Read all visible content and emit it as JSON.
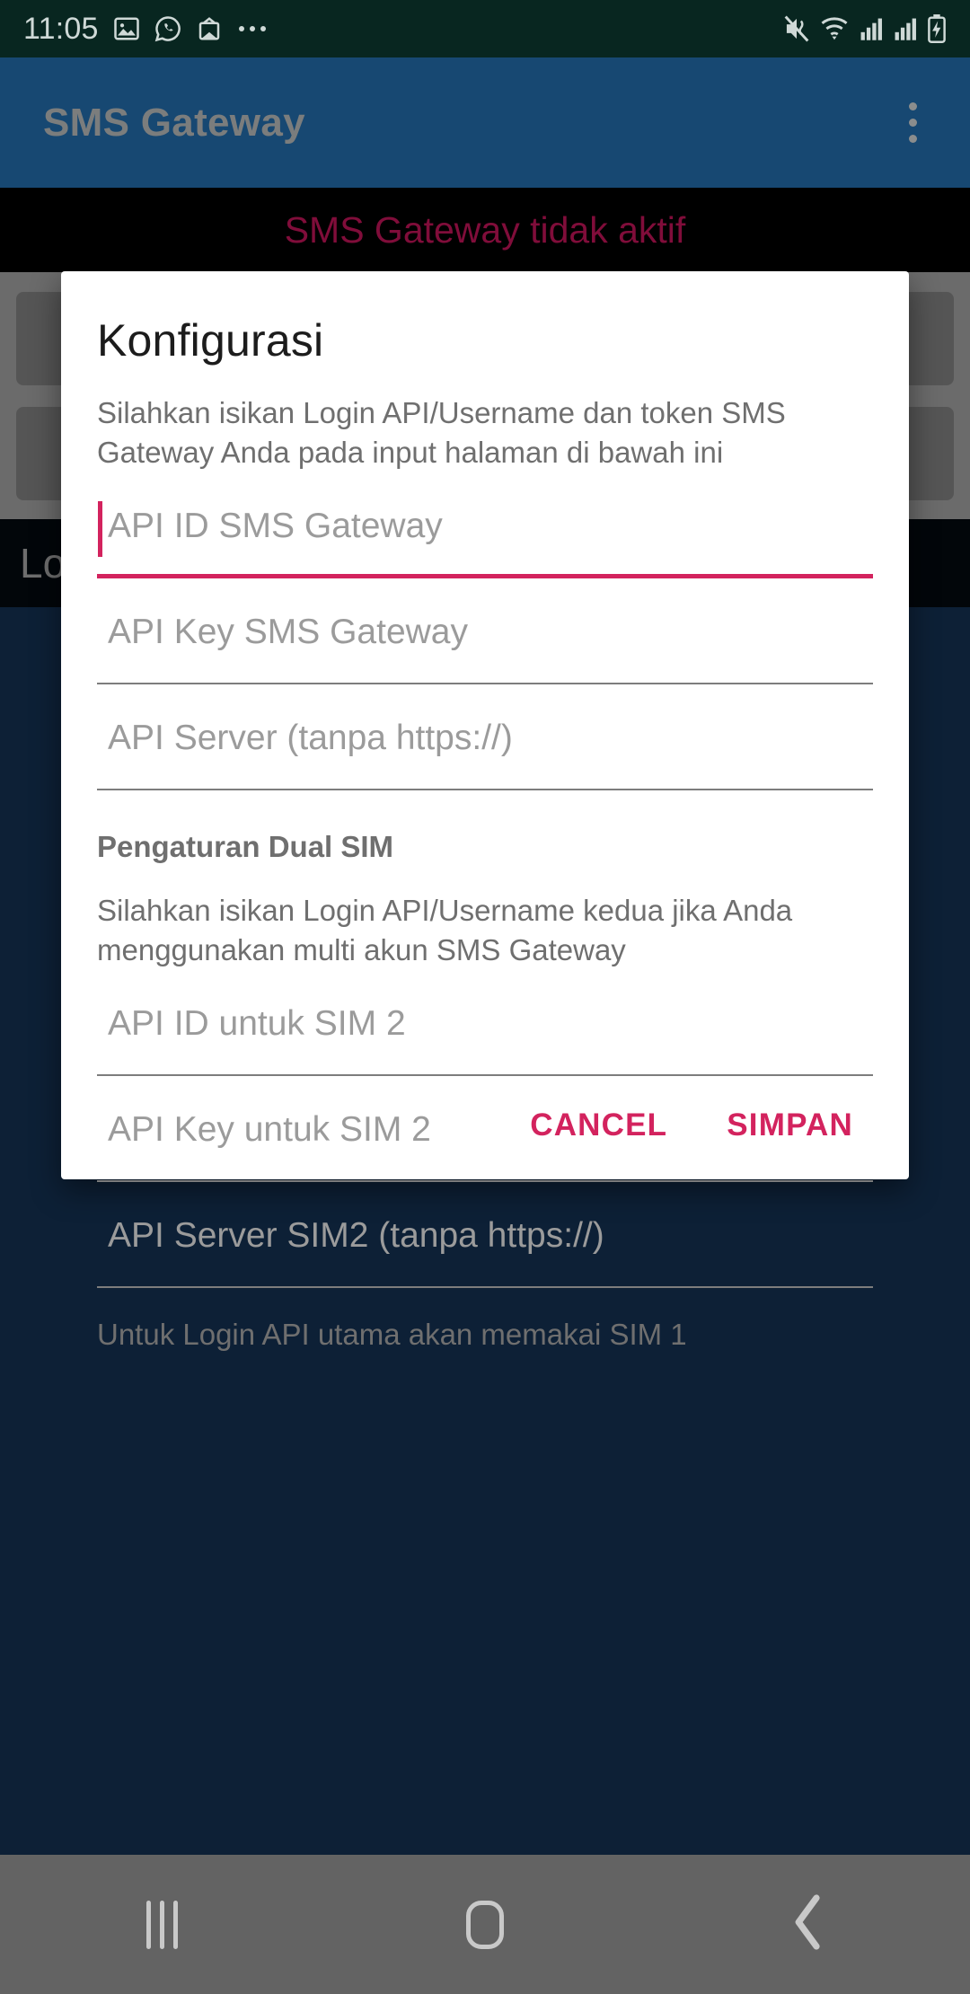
{
  "status_bar": {
    "clock": "11:05",
    "left_icons": [
      "gallery-icon",
      "whatsapp-icon",
      "mail-icon",
      "more-icon"
    ],
    "right_icons": [
      "mute-vibrate-icon",
      "wifi-icon",
      "signal-sim1-icon",
      "signal-sim2-icon",
      "battery-charging-icon"
    ]
  },
  "app_bar": {
    "title": "SMS Gateway",
    "overflow_label": "overflow-menu"
  },
  "banner": {
    "text": "SMS Gateway tidak aktif",
    "color": "#800d3a",
    "background": "#000000"
  },
  "background": {
    "partial_label": "Lo"
  },
  "dialog": {
    "title": "Konfigurasi",
    "description": "Silahkan isikan Login API/Username dan token SMS Gateway Anda pada input halaman di bawah ini",
    "fields": [
      {
        "name": "api-id",
        "placeholder": "API ID SMS Gateway",
        "value": "",
        "focused": true
      },
      {
        "name": "api-key",
        "placeholder": "API Key SMS Gateway",
        "value": "",
        "focused": false
      },
      {
        "name": "api-server",
        "placeholder": "API Server (tanpa https://)",
        "value": "",
        "focused": false
      }
    ],
    "dual_sim": {
      "section_title": "Pengaturan Dual SIM",
      "description": "Silahkan isikan Login API/Username kedua jika Anda menggunakan multi akun SMS Gateway",
      "fields": [
        {
          "name": "api-id-sim2",
          "placeholder": "API ID untuk SIM 2",
          "value": "",
          "focused": false
        },
        {
          "name": "api-key-sim2",
          "placeholder": "API Key untuk SIM 2",
          "value": "",
          "focused": false
        },
        {
          "name": "api-server-sim2",
          "placeholder": "API Server SIM2 (tanpa https://)",
          "value": "",
          "focused": false
        }
      ],
      "note": "Untuk Login API utama akan memakai SIM 1"
    },
    "actions": {
      "cancel": "CANCEL",
      "save": "SIMPAN"
    },
    "accent_color": "#d3235e"
  },
  "nav_bar": {
    "recents_label": "recents-button",
    "home_label": "home-button",
    "back_label": "back-button"
  }
}
